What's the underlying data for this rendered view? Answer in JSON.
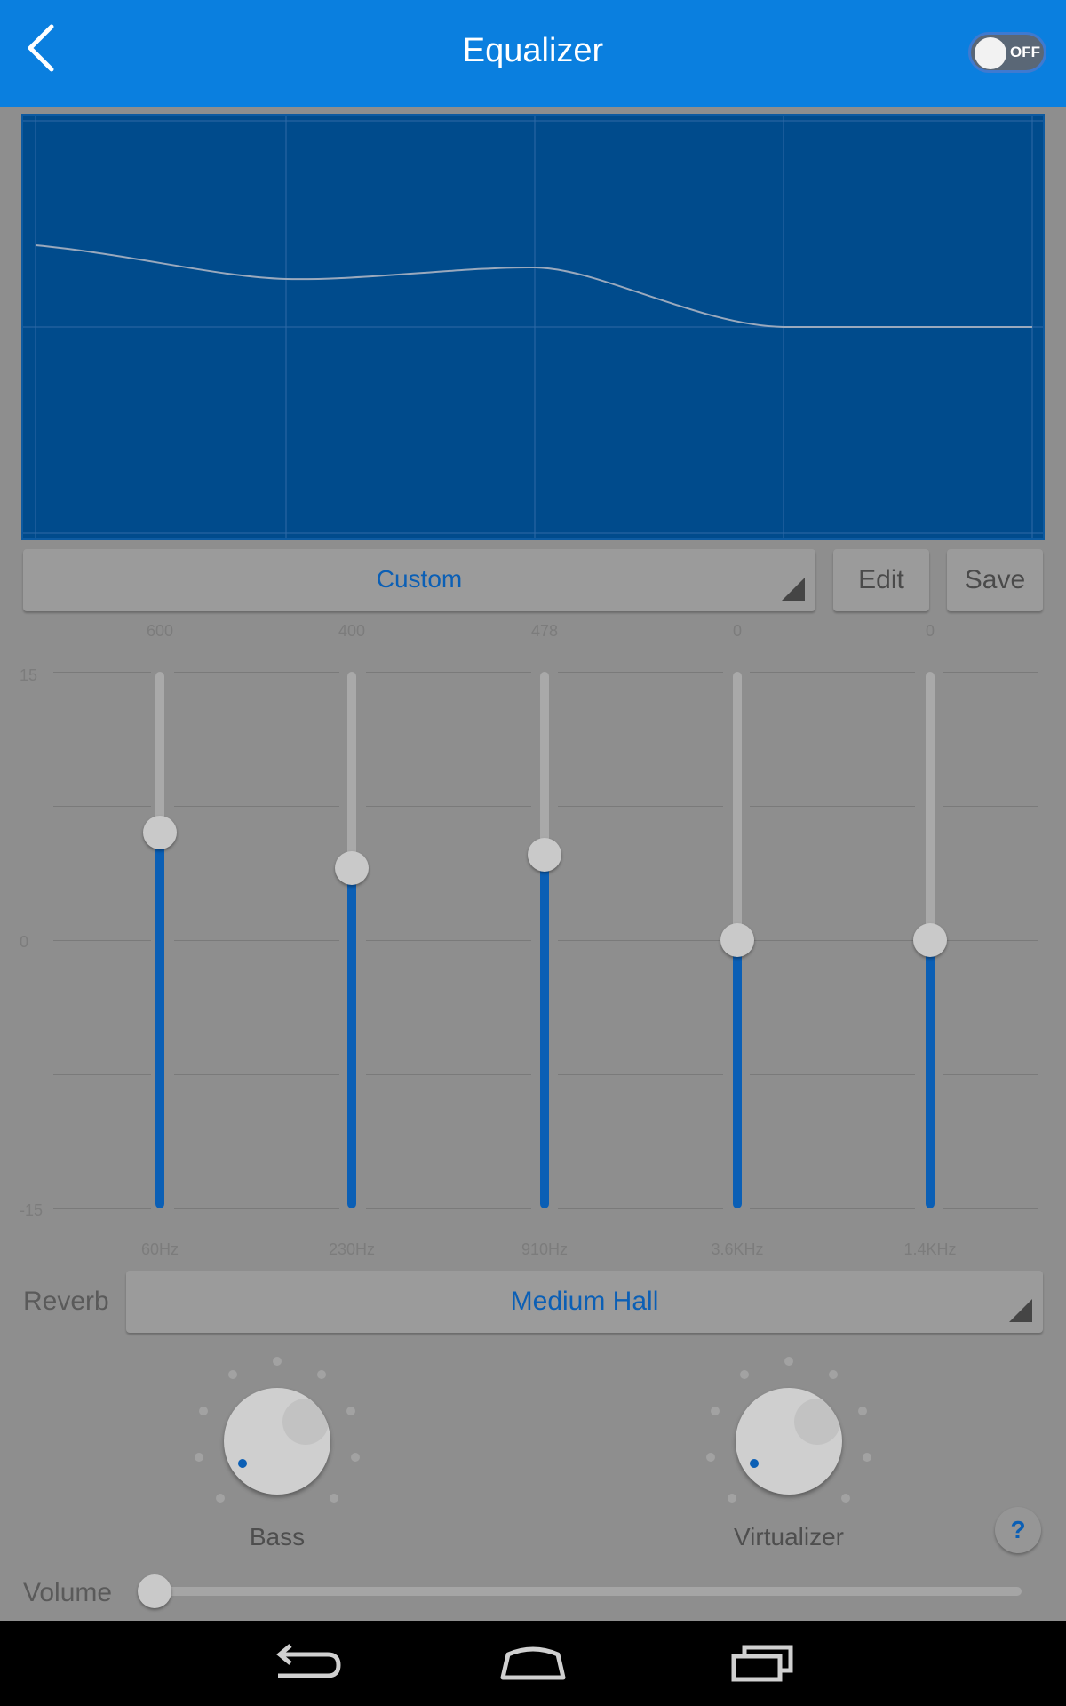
{
  "header": {
    "title": "Equalizer",
    "toggle_label": "OFF",
    "back_icon": "chevron-left-icon"
  },
  "preset": {
    "value": "Custom",
    "edit_label": "Edit",
    "save_label": "Save"
  },
  "eq": {
    "scale_max_label": "15",
    "scale_mid_label": "0",
    "scale_min_label": "-15",
    "bands": [
      {
        "value_label": "600",
        "freq_label": "60Hz",
        "level": 0.7
      },
      {
        "value_label": "400",
        "freq_label": "230Hz",
        "level": 0.634
      },
      {
        "value_label": "478",
        "freq_label": "910Hz",
        "level": 0.659
      },
      {
        "value_label": "0",
        "freq_label": "3.6KHz",
        "level": 0.5
      },
      {
        "value_label": "0",
        "freq_label": "1.4KHz",
        "level": 0.5
      }
    ]
  },
  "reverb": {
    "label": "Reverb",
    "value": "Medium Hall"
  },
  "knobs": {
    "bass_label": "Bass",
    "virtualizer_label": "Virtualizer"
  },
  "help_label": "?",
  "volume": {
    "label": "Volume",
    "level": 0.0
  },
  "navbar": {
    "back_icon": "nav-back-icon",
    "home_icon": "nav-home-icon",
    "recents_icon": "nav-recents-icon"
  },
  "colors": {
    "accent": "#0a7fdf",
    "graph_bg": "#004b8c",
    "slider_fill": "#0b5fb5"
  }
}
